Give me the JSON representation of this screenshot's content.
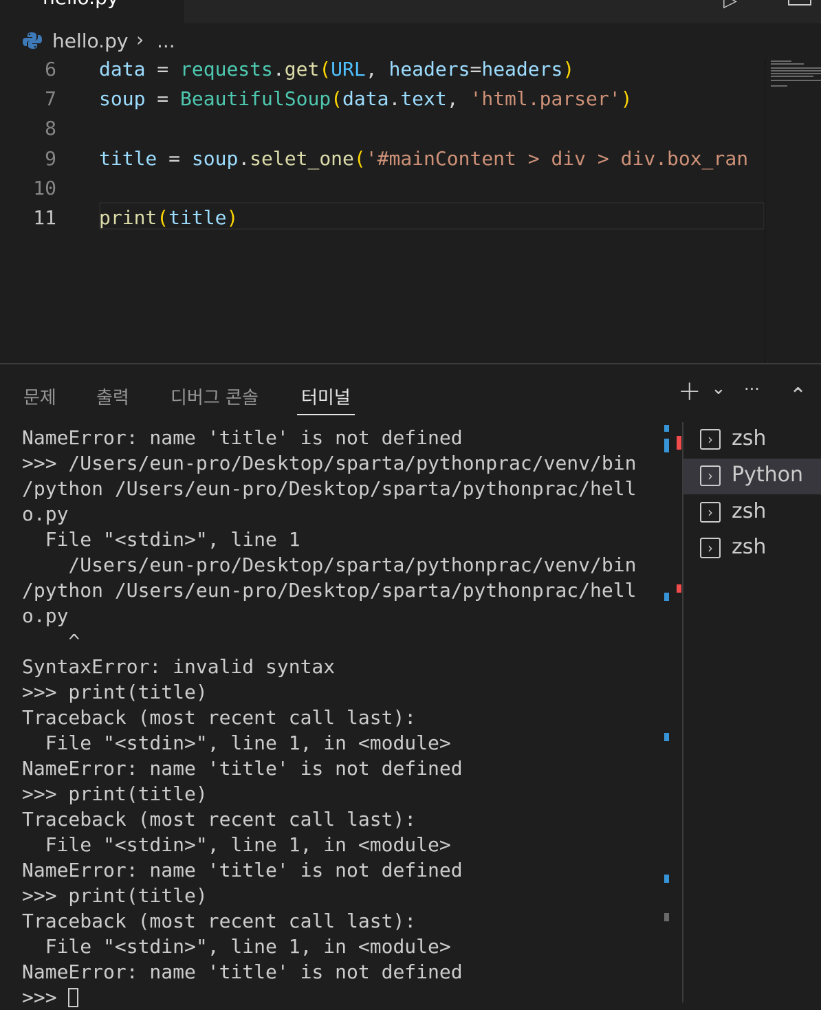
{
  "tab": {
    "label": "hello.py",
    "close": "✕",
    "run": "▷"
  },
  "breadcrumb": {
    "file": "hello.py",
    "separator": "›",
    "more": "..."
  },
  "editor": {
    "line_numbers": [
      "6",
      "7",
      "8",
      "9",
      "10",
      "11"
    ],
    "lines": {
      "l6": {
        "a": "data",
        "b": " = ",
        "c": "requests",
        "d": ".",
        "e": "get",
        "f": "(",
        "g": "URL",
        "h": ", ",
        "i": "headers",
        "j": "=",
        "k": "headers",
        "l": ")"
      },
      "l7": {
        "a": "soup",
        "b": " = ",
        "c": "BeautifulSoup",
        "d": "(",
        "e": "data",
        "f": ".",
        "g": "text",
        "h": ", ",
        "i": "'html.parser'",
        "j": ")"
      },
      "l9": {
        "a": "title",
        "b": " = ",
        "c": "soup",
        "d": ".",
        "e": "selet_one",
        "f": "(",
        "g": "'#mainContent > div > div.box_ran"
      },
      "l11": {
        "a": "print",
        "b": "(",
        "c": "title",
        "d": ")"
      }
    }
  },
  "panel": {
    "tabs": [
      "문제",
      "출력",
      "디버그 콘솔",
      "터미널"
    ],
    "actions": {
      "add": "+",
      "dropdown": "⌄",
      "more": "···",
      "collapse": "⌃"
    },
    "terminal_lines": [
      "NameError: name 'title' is not defined",
      ">>> /Users/eun-pro/Desktop/sparta/pythonprac/venv/bin",
      "/python /Users/eun-pro/Desktop/sparta/pythonprac/hell",
      "o.py",
      "  File \"<stdin>\", line 1",
      "    /Users/eun-pro/Desktop/sparta/pythonprac/venv/bin",
      "/python /Users/eun-pro/Desktop/sparta/pythonprac/hell",
      "o.py",
      "    ^",
      "SyntaxError: invalid syntax",
      ">>> print(title)",
      "Traceback (most recent call last):",
      "  File \"<stdin>\", line 1, in <module>",
      "NameError: name 'title' is not defined",
      ">>> print(title)",
      "Traceback (most recent call last):",
      "  File \"<stdin>\", line 1, in <module>",
      "NameError: name 'title' is not defined",
      ">>> print(title)",
      "Traceback (most recent call last):",
      "  File \"<stdin>\", line 1, in <module>",
      "NameError: name 'title' is not defined"
    ],
    "prompt": ">>> ",
    "terminals": [
      "zsh",
      "Python",
      "zsh",
      "zsh"
    ],
    "terminal_icon": "›"
  },
  "colors": {
    "keyword_blue": "#9cdcfe",
    "function_yellow": "#dcdcaa",
    "class_teal": "#4ec9b0",
    "string_orange": "#ce9178",
    "marker_blue": "#3794d6",
    "marker_red": "#f14c4c"
  }
}
